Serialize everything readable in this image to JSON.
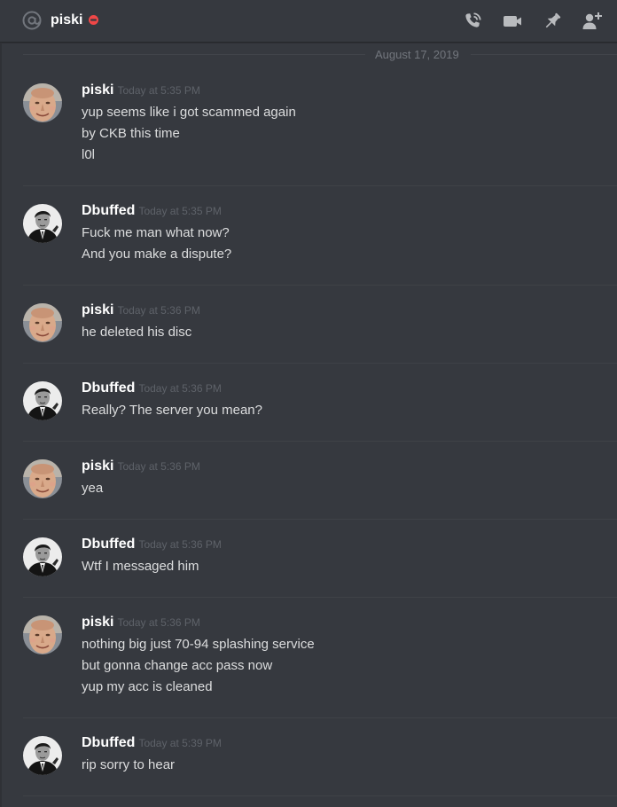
{
  "header": {
    "dm_name": "piski",
    "icons": {
      "channel": "at-sign-icon",
      "status": "do-not-disturb-icon",
      "call": "phone-call-icon",
      "video": "video-call-icon",
      "pin": "pin-icon",
      "add_friend": "add-friend-icon"
    }
  },
  "date_divider": "August 17, 2019",
  "colors": {
    "background": "#36393f",
    "username": "#ffffff",
    "message_text": "#dcddde",
    "timestamp": "#5e6269",
    "dnd_status": "#f04747"
  },
  "messages": [
    {
      "author": "piski",
      "avatar": "piski-avatar",
      "timestamp": "Today at 5:35 PM",
      "lines": [
        "yup seems like i got scammed again",
        "by CKB this time",
        "l0l"
      ]
    },
    {
      "author": "Dbuffed",
      "avatar": "dbuffed-avatar",
      "timestamp": "Today at 5:35 PM",
      "lines": [
        "Fuck me man what now?",
        "And you make a dispute?"
      ]
    },
    {
      "author": "piski",
      "avatar": "piski-avatar",
      "timestamp": "Today at 5:36 PM",
      "lines": [
        "he deleted his disc"
      ]
    },
    {
      "author": "Dbuffed",
      "avatar": "dbuffed-avatar",
      "timestamp": "Today at 5:36 PM",
      "lines": [
        "Really? The server you mean?"
      ]
    },
    {
      "author": "piski",
      "avatar": "piski-avatar",
      "timestamp": "Today at 5:36 PM",
      "lines": [
        "yea"
      ]
    },
    {
      "author": "Dbuffed",
      "avatar": "dbuffed-avatar",
      "timestamp": "Today at 5:36 PM",
      "lines": [
        "Wtf I messaged him"
      ]
    },
    {
      "author": "piski",
      "avatar": "piski-avatar",
      "timestamp": "Today at 5:36 PM",
      "lines": [
        "nothing big just 70-94 splashing service",
        "but gonna change acc pass now",
        "yup my acc is cleaned"
      ]
    },
    {
      "author": "Dbuffed",
      "avatar": "dbuffed-avatar",
      "timestamp": "Today at 5:39 PM",
      "lines": [
        "rip sorry to hear"
      ]
    }
  ]
}
